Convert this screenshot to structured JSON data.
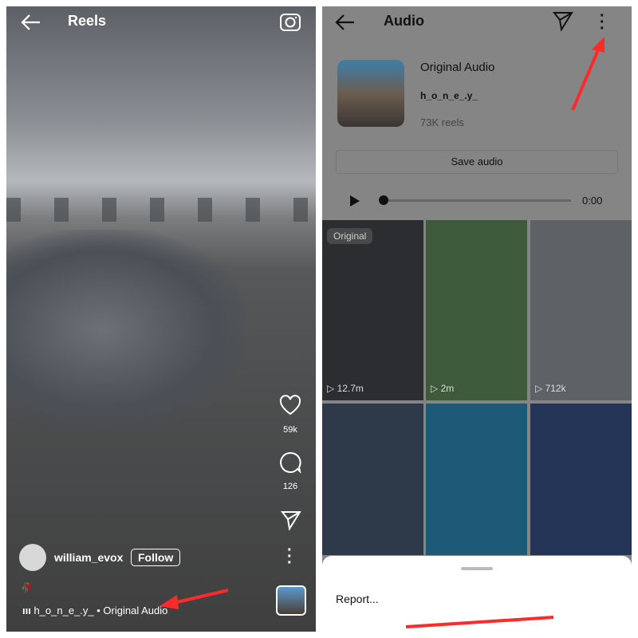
{
  "left": {
    "header": {
      "title": "Reels",
      "back_icon": "arrow-left-icon",
      "camera_icon": "camera-icon"
    },
    "actions": {
      "likes": "59k",
      "comments": "126"
    },
    "author": {
      "username": "william_evox",
      "follow_label": "Follow"
    },
    "audio": {
      "text": "h_o_n_e_.y_ • Original Audio"
    }
  },
  "right": {
    "header": {
      "title": "Audio"
    },
    "audio": {
      "title": "Original Audio",
      "artist": "h_o_n_e_.y_",
      "reels_count": "73K reels",
      "save_label": "Save audio",
      "time": "0:00",
      "progress": 0
    },
    "grid": [
      {
        "badge": "Original",
        "count": "12.7m",
        "color": "#2b2d30"
      },
      {
        "badge": "",
        "count": "2m",
        "color": "#3d5a3a"
      },
      {
        "badge": "",
        "count": "712k",
        "color": "#5e6266"
      },
      {
        "badge": "",
        "count": "",
        "color": "#2e3a4a"
      },
      {
        "badge": "",
        "count": "",
        "color": "#1d5a78"
      },
      {
        "badge": "",
        "count": "",
        "color": "#243456"
      }
    ],
    "sheet": {
      "report_label": "Report..."
    }
  },
  "annotation_color": "#ff2a2a"
}
